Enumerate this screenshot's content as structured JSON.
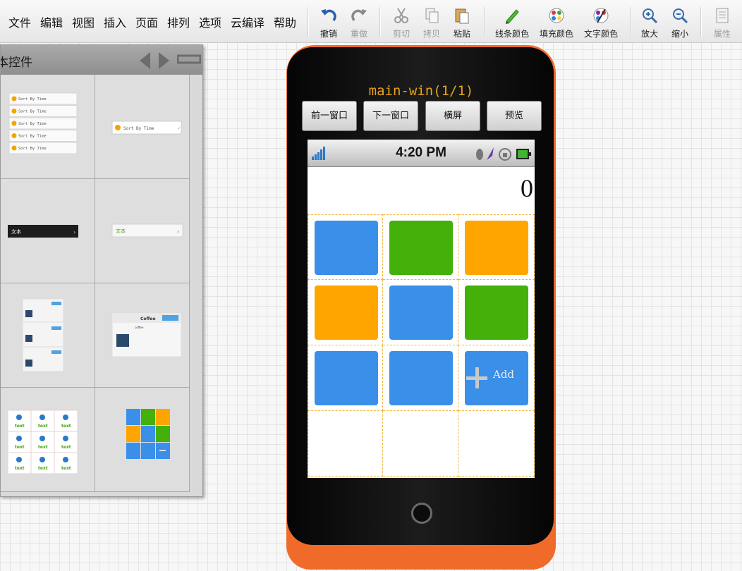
{
  "menu": [
    "文件",
    "编辑",
    "视图",
    "插入",
    "页面",
    "排列",
    "选项",
    "云编译",
    "帮助"
  ],
  "toolbar": {
    "undo": "撤销",
    "redo": "重做",
    "cut": "剪切",
    "copy": "拷贝",
    "paste": "粘贴",
    "line_color": "线条颜色",
    "fill_color": "填充颜色",
    "text_color": "文字颜色",
    "zoom_in": "放大",
    "zoom_out": "缩小",
    "properties": "属性"
  },
  "panel": {
    "title": "本控件",
    "list_item_text": "Sort By Time",
    "dark_item_text": "文本",
    "light_item_text": "文本",
    "card_title": "Coffee",
    "card_sub": "coffee",
    "grid_item_text": "text"
  },
  "phone": {
    "window_title": "main-win(1/1)",
    "buttons": [
      "前一窗口",
      "下一窗口",
      "横屏",
      "预览"
    ],
    "status_time": "4:20 PM",
    "display_value": "0",
    "add_label": "Add"
  },
  "colors": {
    "blue": "#3a8fe8",
    "green": "#44b00a",
    "orange": "#ffa500",
    "phone_body": "#f06b2a",
    "title_color": "#e8a21a"
  },
  "tiles": [
    "blue",
    "green",
    "orange",
    "orange",
    "blue",
    "green",
    "blue",
    "blue",
    "blue-add"
  ]
}
